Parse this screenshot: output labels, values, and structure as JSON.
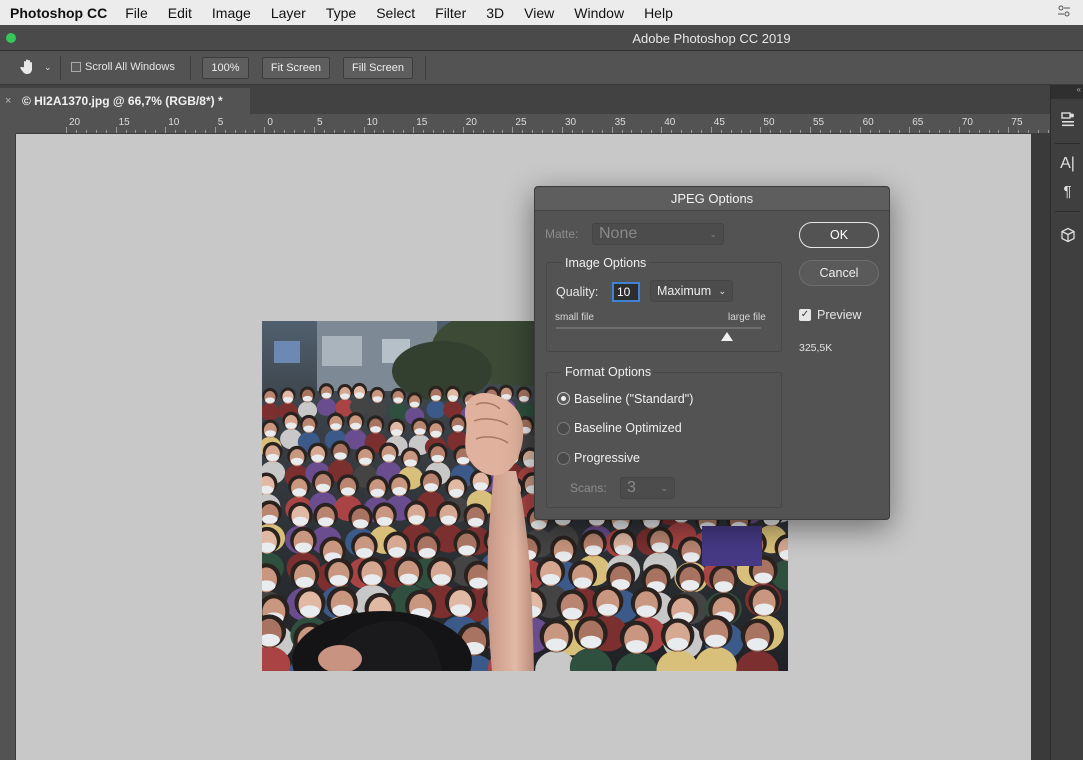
{
  "menubar": {
    "app": "Photoshop CC",
    "items": [
      "File",
      "Edit",
      "Image",
      "Layer",
      "Type",
      "Select",
      "Filter",
      "3D",
      "View",
      "Window",
      "Help"
    ]
  },
  "window": {
    "title": "Adobe Photoshop CC 2019"
  },
  "options_bar": {
    "scroll_all_windows": "Scroll All Windows",
    "zoom_100": "100%",
    "fit_screen": "Fit Screen",
    "fill_screen": "Fill Screen"
  },
  "document": {
    "tab_title": "© HI2A1370.jpg @ 66,7% (RGB/8*) *"
  },
  "ruler": {
    "labels": [
      "20",
      "15",
      "10",
      "5",
      "0",
      "5",
      "10",
      "15",
      "20",
      "25",
      "30",
      "35",
      "40",
      "45",
      "50",
      "55",
      "60",
      "65",
      "70",
      "75"
    ]
  },
  "dialog": {
    "title": "JPEG Options",
    "matte_label": "Matte:",
    "matte_value": "None",
    "image_options": "Image Options",
    "quality_label": "Quality:",
    "quality_value": "10",
    "quality_preset": "Maximum",
    "quality_max": 12,
    "small_file": "small file",
    "large_file": "large file",
    "format_options": "Format Options",
    "baseline_standard": "Baseline (\"Standard\")",
    "baseline_optimized": "Baseline Optimized",
    "progressive": "Progressive",
    "scans_label": "Scans:",
    "scans_value": "3",
    "selected_format": "baseline_standard",
    "ok": "OK",
    "cancel": "Cancel",
    "preview": "Preview",
    "preview_checked": true,
    "file_size": "325,5K"
  },
  "colors": {
    "accent_focus": "#3f83d6",
    "traffic_green": "#35c759"
  }
}
